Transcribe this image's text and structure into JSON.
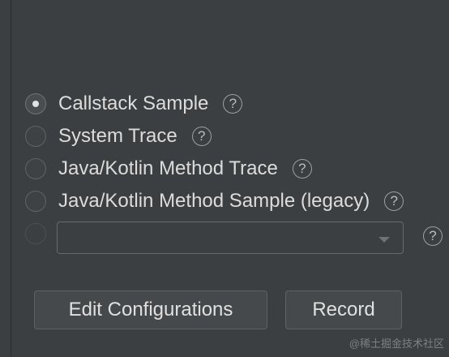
{
  "options": [
    {
      "label": "Callstack Sample",
      "checked": true,
      "help": "?"
    },
    {
      "label": "System Trace",
      "checked": false,
      "help": "?"
    },
    {
      "label": "Java/Kotlin Method Trace",
      "checked": false,
      "help": "?"
    },
    {
      "label": "Java/Kotlin Method Sample (legacy)",
      "checked": false,
      "help": "?"
    }
  ],
  "custom_option": {
    "selected_value": "",
    "disabled": true,
    "help": "?"
  },
  "buttons": {
    "edit_configurations": "Edit Configurations",
    "record": "Record"
  },
  "watermark": "@稀土掘金技术社区",
  "icons": {
    "help": "question-circle-icon",
    "dropdown": "chevron-down-icon"
  },
  "colors": {
    "background": "#3c3f41",
    "text": "#dcdcdc",
    "border": "#606366"
  }
}
